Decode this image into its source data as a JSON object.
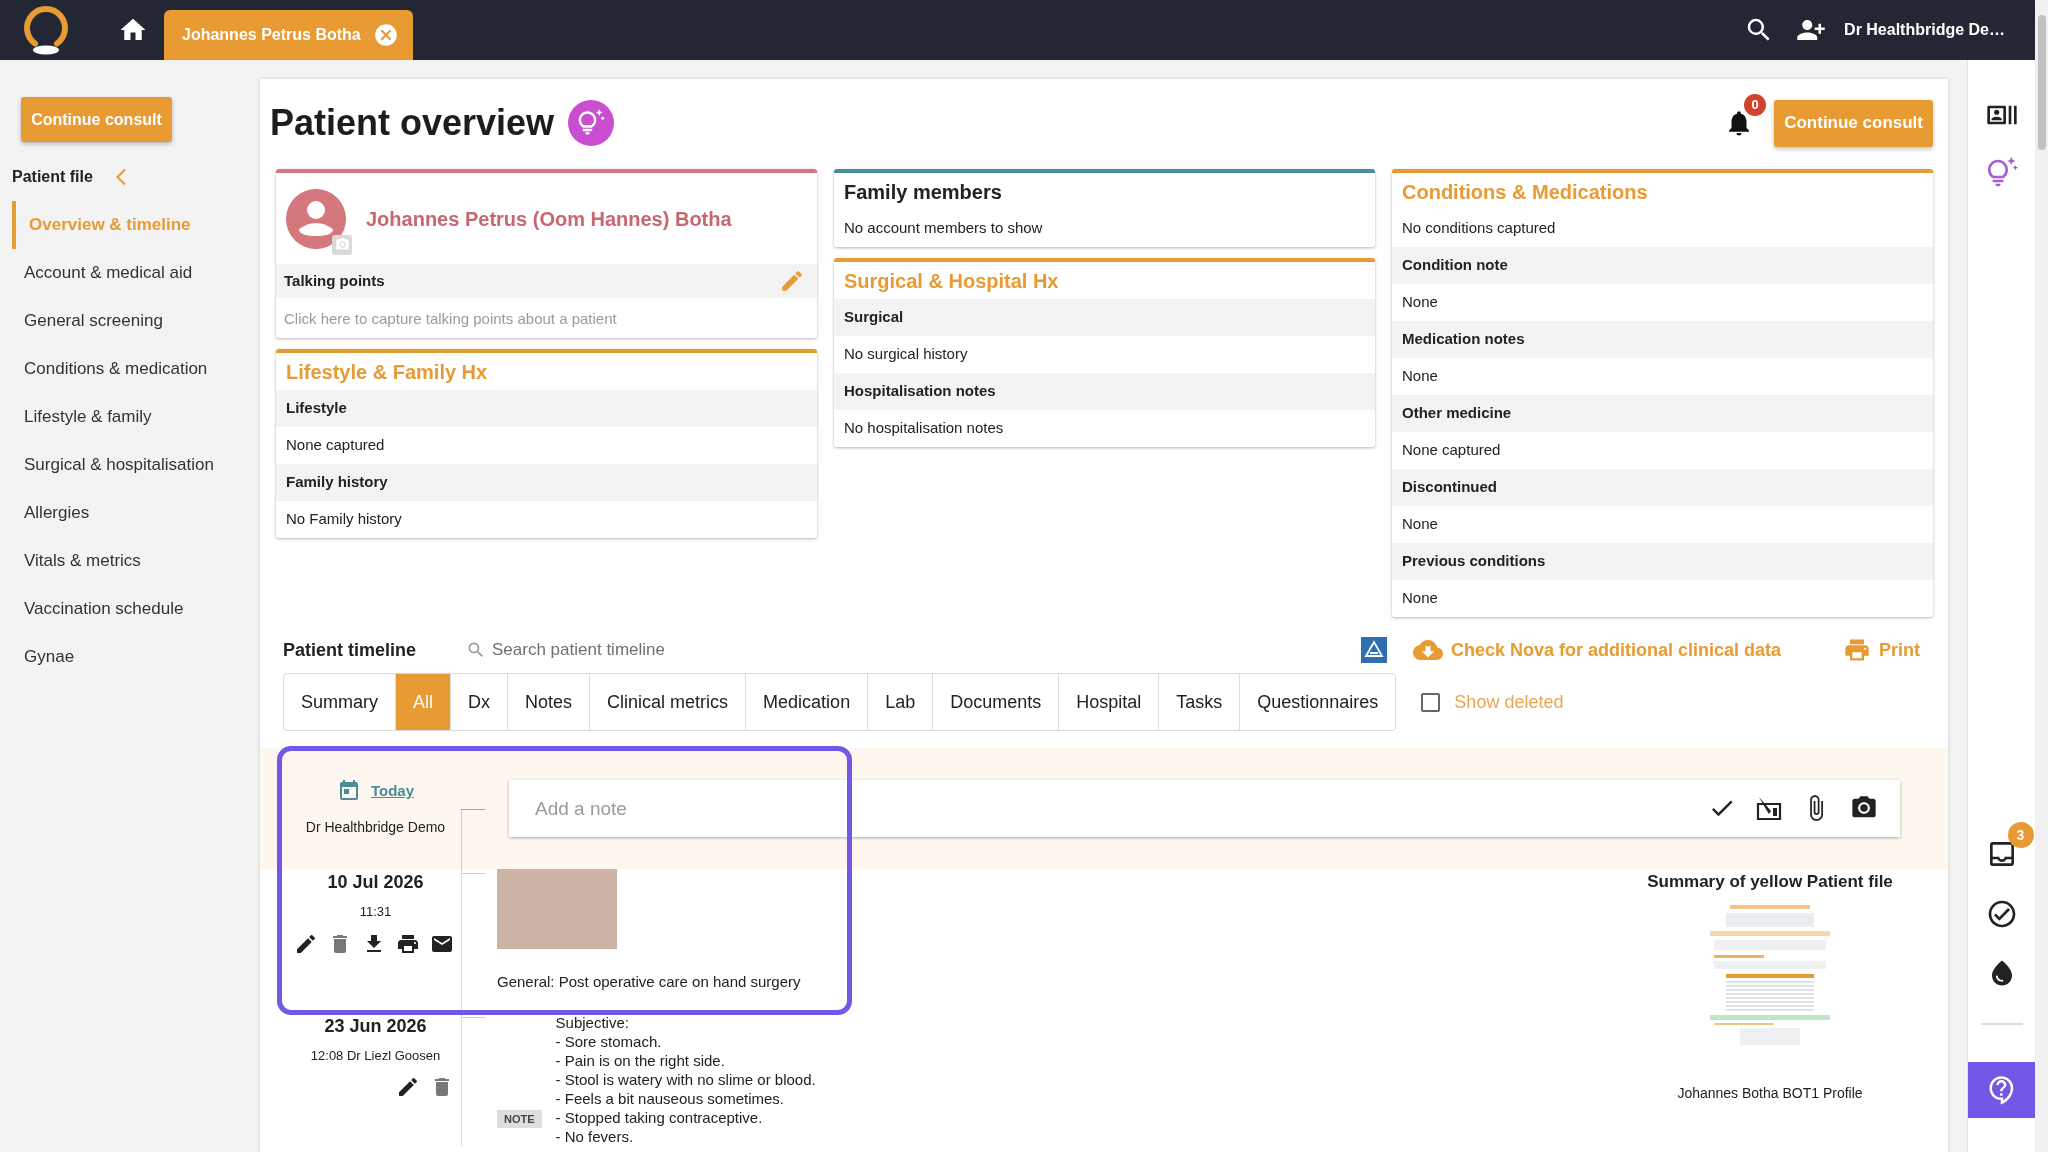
{
  "top_bar": {
    "patient_tab": "Johannes Petrus Botha",
    "user_name": "Dr Healthbridge De…"
  },
  "sidebar": {
    "continue_button": "Continue consult",
    "title": "Patient file",
    "items": [
      {
        "label": "Overview & timeline",
        "selected": true
      },
      {
        "label": "Account & medical aid",
        "selected": false
      },
      {
        "label": "General screening",
        "selected": false
      },
      {
        "label": "Conditions & medication",
        "selected": false
      },
      {
        "label": "Lifestyle & family",
        "selected": false
      },
      {
        "label": "Surgical & hospitalisation",
        "selected": false
      },
      {
        "label": "Allergies",
        "selected": false
      },
      {
        "label": "Vitals & metrics",
        "selected": false
      },
      {
        "label": "Vaccination schedule",
        "selected": false
      },
      {
        "label": "Gynae",
        "selected": false
      }
    ]
  },
  "overview": {
    "title": "Patient overview",
    "notification_count": "0",
    "continue_button": "Continue consult",
    "columns": [
      [
        {
          "kind": "profile",
          "color": "#d4787e",
          "name": "Johannes Petrus (Oom Hannes) Botha",
          "talking_points": {
            "label": "Talking points",
            "placeholder": "Click here to capture talking points about a patient"
          }
        },
        {
          "kind": "section",
          "color": "#e89a33",
          "title": "Lifestyle & Family Hx",
          "rows": [
            {
              "kind": "label",
              "text": "Lifestyle"
            },
            {
              "kind": "value",
              "text": "None captured"
            },
            {
              "kind": "label",
              "text": "Family history"
            },
            {
              "kind": "value",
              "text": "No Family history"
            }
          ]
        }
      ],
      [
        {
          "kind": "plain",
          "color": "#4a8c97",
          "title": "Family members",
          "rows": [
            {
              "kind": "value",
              "text": "No account members to show"
            }
          ]
        },
        {
          "kind": "section",
          "color": "#e89a33",
          "title": "Surgical & Hospital Hx",
          "rows": [
            {
              "kind": "label",
              "text": "Surgical"
            },
            {
              "kind": "value",
              "text": "No surgical history"
            },
            {
              "kind": "label",
              "text": "Hospitalisation notes"
            },
            {
              "kind": "value",
              "text": "No hospitalisation notes"
            }
          ]
        }
      ],
      [
        {
          "kind": "section",
          "color": "#e89a33",
          "title": "Conditions & Medications",
          "rows": [
            {
              "kind": "value",
              "text": "No conditions captured"
            },
            {
              "kind": "label",
              "text": "Condition note"
            },
            {
              "kind": "value",
              "text": "None"
            },
            {
              "kind": "label",
              "text": "Medication notes"
            },
            {
              "kind": "value",
              "text": "None"
            },
            {
              "kind": "label",
              "text": "Other medicine"
            },
            {
              "kind": "value",
              "text": "None captured"
            },
            {
              "kind": "label",
              "text": "Discontinued"
            },
            {
              "kind": "value",
              "text": "None"
            },
            {
              "kind": "label",
              "text": "Previous conditions"
            },
            {
              "kind": "value",
              "text": "None"
            }
          ]
        }
      ]
    ]
  },
  "timeline": {
    "title": "Patient timeline",
    "search": {
      "placeholder": "Search patient timeline"
    },
    "nova_link": "Check Nova for additional clinical data",
    "print_button": "Print",
    "tabs": [
      {
        "label": "Summary",
        "selected": false
      },
      {
        "label": "All",
        "selected": true
      },
      {
        "label": "Dx",
        "selected": false
      },
      {
        "label": "Notes",
        "selected": false
      },
      {
        "label": "Clinical metrics",
        "selected": false
      },
      {
        "label": "Medication",
        "selected": false
      },
      {
        "label": "Lab",
        "selected": false
      },
      {
        "label": "Documents",
        "selected": false
      },
      {
        "label": "Hospital",
        "selected": false
      },
      {
        "label": "Tasks",
        "selected": false
      },
      {
        "label": "Questionnaires",
        "selected": false
      }
    ],
    "show_deleted": {
      "label": "Show deleted",
      "checked": false
    },
    "composer": {
      "date_link": "Today",
      "author": "Dr Healthbridge Demo",
      "placeholder": "Add a note"
    },
    "entries": [
      {
        "kind": "image",
        "date": "10 Jul 2026",
        "meta": "11:31",
        "actions": [
          {
            "kind": "edit"
          },
          {
            "kind": "delete"
          },
          {
            "kind": "download"
          },
          {
            "kind": "print"
          },
          {
            "kind": "email"
          }
        ],
        "caption": "General: Post operative care on hand surgery"
      },
      {
        "kind": "note",
        "date": "23 Jun 2026",
        "meta": "12:08 Dr Liezl Goosen",
        "actions": [
          {
            "kind": "edit"
          },
          {
            "kind": "delete"
          }
        ],
        "badge": "NOTE",
        "text": "Subjective:\n- Sore stomach.\n- Pain is on the right side.\n- Stool is watery with no slime or blood.\n- Feels a bit nauseous sometimes.\n- Stopped taking contraceptive.\n- No fevers."
      }
    ],
    "document": {
      "title": "Summary of yellow Patient file",
      "caption": "Johannes Botha BOT1 Profile"
    }
  },
  "right_rail": {
    "inbox_count": "3"
  }
}
